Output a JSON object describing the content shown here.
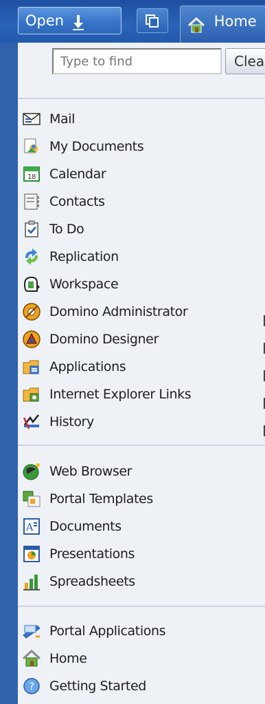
{
  "topbar": {
    "open_label": "Open",
    "home_tab_label": "Home"
  },
  "search": {
    "placeholder": "Type to find",
    "clear_label": "Clear"
  },
  "sections": [
    [
      {
        "label": "Mail",
        "icon": "mail-icon"
      },
      {
        "label": "My Documents",
        "icon": "my-documents-icon"
      },
      {
        "label": "Calendar",
        "icon": "calendar-icon"
      },
      {
        "label": "Contacts",
        "icon": "contacts-icon"
      },
      {
        "label": "To Do",
        "icon": "todo-icon"
      },
      {
        "label": "Replication",
        "icon": "replication-icon"
      },
      {
        "label": "Workspace",
        "icon": "workspace-icon"
      },
      {
        "label": "Domino Administrator",
        "icon": "domino-administrator-icon"
      },
      {
        "label": "Domino Designer",
        "icon": "domino-designer-icon"
      },
      {
        "label": "Applications",
        "icon": "applications-folder-icon"
      },
      {
        "label": "Internet Explorer Links",
        "icon": "ie-links-folder-icon"
      },
      {
        "label": "History",
        "icon": "history-icon"
      }
    ],
    [
      {
        "label": "Web Browser",
        "icon": "web-browser-icon"
      },
      {
        "label": "Portal Templates",
        "icon": "portal-templates-icon"
      },
      {
        "label": "Documents",
        "icon": "documents-icon"
      },
      {
        "label": "Presentations",
        "icon": "presentations-icon"
      },
      {
        "label": "Spreadsheets",
        "icon": "spreadsheets-icon"
      }
    ],
    [
      {
        "label": "Portal Applications",
        "icon": "portal-applications-icon"
      },
      {
        "label": "Home",
        "icon": "home-icon"
      },
      {
        "label": "Getting Started",
        "icon": "getting-started-icon"
      }
    ]
  ]
}
